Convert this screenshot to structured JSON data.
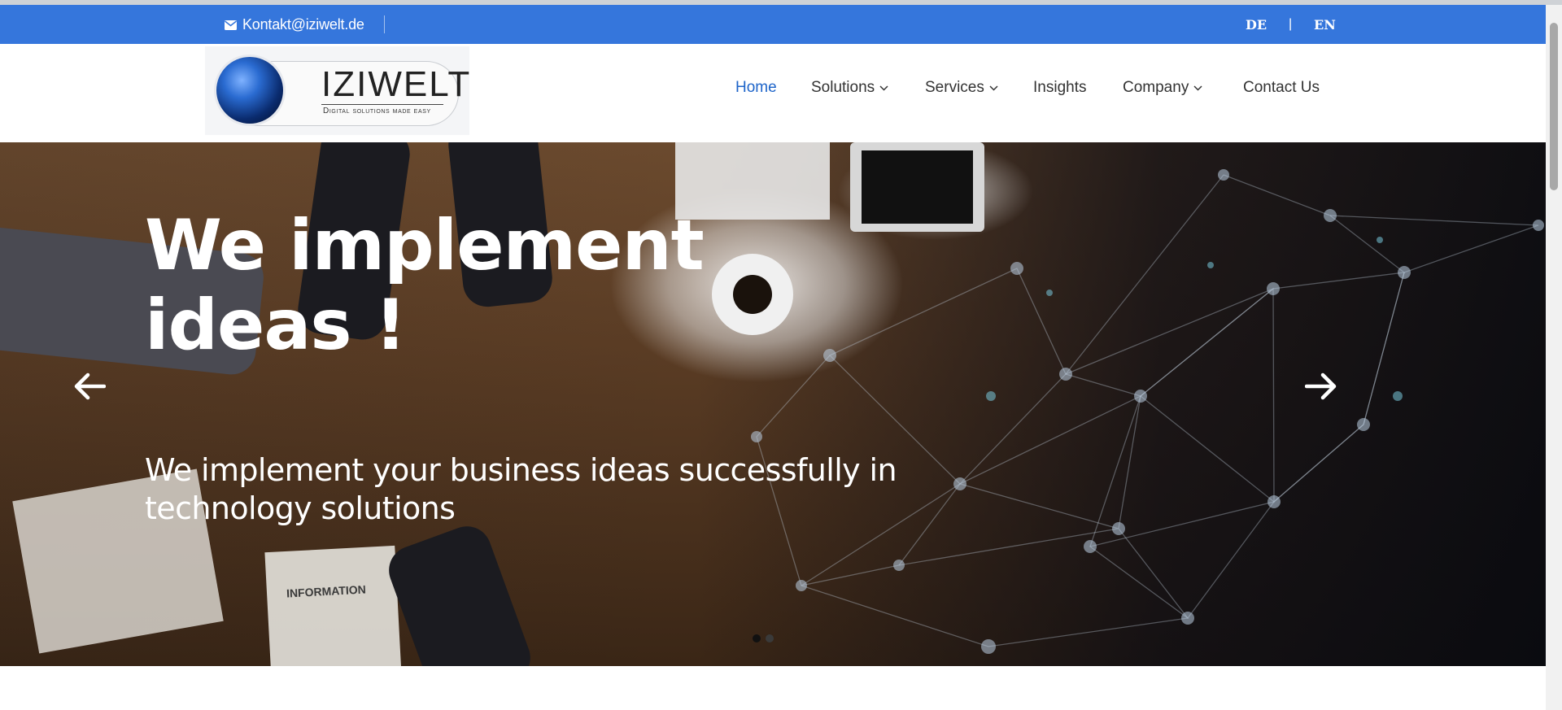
{
  "topbar": {
    "email": "Kontakt@iziwelt.de",
    "lang_de": "DE",
    "lang_separator": "|",
    "lang_en": "EN",
    "background": "#3576dc"
  },
  "logo": {
    "brand": "IZIWELT",
    "tagline": "Digital solutions made easy"
  },
  "nav": {
    "items": [
      {
        "label": "Home",
        "active": true,
        "dropdown": false
      },
      {
        "label": "Solutions",
        "active": false,
        "dropdown": true
      },
      {
        "label": "Services",
        "active": false,
        "dropdown": true
      },
      {
        "label": "Insights",
        "active": false,
        "dropdown": false
      },
      {
        "label": "Company",
        "active": false,
        "dropdown": true
      },
      {
        "label": "Contact Us",
        "active": false,
        "dropdown": false
      }
    ],
    "active_color": "#1d64c9"
  },
  "hero": {
    "headline": "We implement ideas !",
    "subtitle": "We implement your business ideas successfully in technology solutions",
    "image_text": "INFORMATION",
    "prev_icon": "arrow-left-icon",
    "next_icon": "arrow-right-icon",
    "slides_total": 2,
    "active_slide": 1
  }
}
